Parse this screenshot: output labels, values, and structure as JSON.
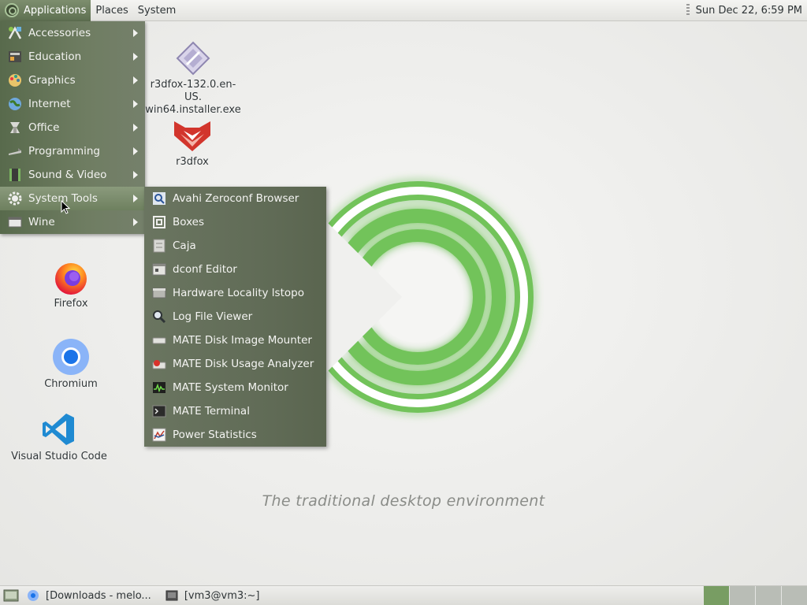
{
  "top_panel": {
    "menus": [
      "Applications",
      "Places",
      "System"
    ],
    "clock": "Sun Dec 22,  6:59 PM"
  },
  "app_menu": {
    "items": [
      {
        "label": "Accessories",
        "icon": "accessories-icon"
      },
      {
        "label": "Education",
        "icon": "education-icon"
      },
      {
        "label": "Graphics",
        "icon": "graphics-icon"
      },
      {
        "label": "Internet",
        "icon": "internet-icon"
      },
      {
        "label": "Office",
        "icon": "office-icon"
      },
      {
        "label": "Programming",
        "icon": "programming-icon"
      },
      {
        "label": "Sound & Video",
        "icon": "sound-video-icon"
      },
      {
        "label": "System Tools",
        "icon": "system-tools-icon"
      },
      {
        "label": "Wine",
        "icon": "wine-icon"
      }
    ],
    "hovered": "System Tools"
  },
  "system_tools_menu": {
    "items": [
      "Avahi Zeroconf Browser",
      "Boxes",
      "Caja",
      "dconf Editor",
      "Hardware Locality lstopo",
      "Log File Viewer",
      "MATE Disk Image Mounter",
      "MATE Disk Usage Analyzer",
      "MATE System Monitor",
      "MATE Terminal",
      "Power Statistics"
    ]
  },
  "desktop": {
    "icons": {
      "installer": {
        "line1": "r3dfox-132.0.en-US.",
        "line2": "win64.installer.exe"
      },
      "r3dfox": "r3dfox",
      "firefox": "Firefox",
      "chromium": "Chromium",
      "vscode": "Visual Studio Code"
    },
    "tagline": "The traditional desktop environment"
  },
  "taskbar": {
    "tasks": [
      "[Downloads - melo...",
      "[vm3@vm3:~]"
    ],
    "workspaces": 4,
    "active_workspace": 1
  },
  "colors": {
    "menu_bg": "#5f6e54",
    "accent_green": "#6fbf5a",
    "active_workspace": "#789d63"
  }
}
